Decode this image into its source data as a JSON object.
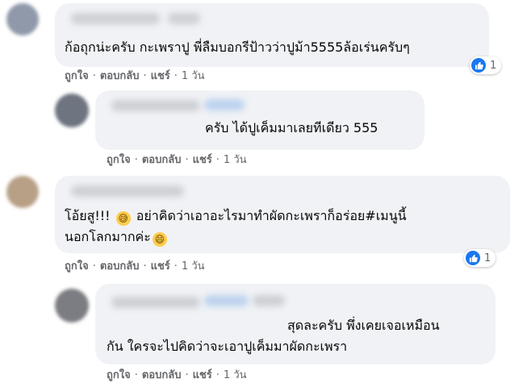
{
  "comments": [
    {
      "text": "ก้อถุกน่ะครับ กะเพราปู พี่ลืมบอกรีป้าวว่าปูม้า5555ล้อเร่นครับๆ",
      "actions": {
        "like": "ถูกใจ",
        "reply": "ตอบกลับ",
        "share": "แชร์",
        "time": "1 วัน"
      },
      "reaction": {
        "icon": "like-icon",
        "count": "1"
      }
    },
    {
      "text": "ครับ ได้ปูเค็มมาเลยทีเดียว 555",
      "actions": {
        "like": "ถูกใจ",
        "reply": "ตอบกลับ",
        "share": "แชร์",
        "time": "1 วัน"
      }
    },
    {
      "text_line1_a": "โอ้ยสู!!!",
      "text_line1_b": "อย่าคิดว่าเอาอะไรมาทำผัดกะเพราก็อร่อย#เมนูนี้",
      "text_line2": "นอกโลกมากค่ะ",
      "emoji": "😅",
      "emoji2": "😄",
      "actions": {
        "like": "ถูกใจ",
        "reply": "ตอบกลับ",
        "share": "แชร์",
        "time": "1 วัน"
      },
      "reaction": {
        "icon": "like-icon",
        "count": "1"
      }
    },
    {
      "text_line1": "สุดละครับ พึ่งเคยเจอเหมือน",
      "text_line2": "กัน ใครจะไปคิดว่าจะเอาปูเค็มมาผัดกะเพรา",
      "actions": {
        "like": "ถูกใจ",
        "reply": "ตอบกลับ",
        "share": "แชร์",
        "time": "1 วัน"
      }
    }
  ],
  "separator": "·",
  "colors": {
    "bubble": "#f0f2f5",
    "meta": "#65676b",
    "like_blue": "#1877f2"
  }
}
